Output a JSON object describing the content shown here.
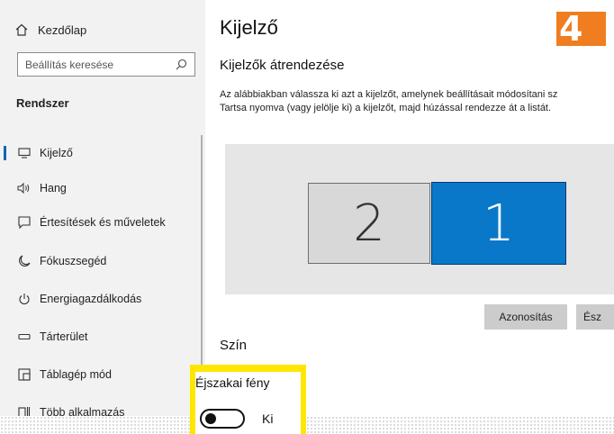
{
  "sidebar": {
    "home_label": "Kezdőlap",
    "search_placeholder": "Beállítás keresése",
    "section_title": "Rendszer",
    "items": [
      {
        "label": "Kijelző",
        "icon": "monitor-icon",
        "active": true
      },
      {
        "label": "Hang",
        "icon": "speaker-icon",
        "active": false
      },
      {
        "label": "Értesítések és műveletek",
        "icon": "notification-icon",
        "active": false
      },
      {
        "label": "Fókuszsegéd",
        "icon": "moon-icon",
        "active": false
      },
      {
        "label": "Energiagazdálkodás",
        "icon": "power-icon",
        "active": false
      },
      {
        "label": "Tárterület",
        "icon": "storage-icon",
        "active": false
      },
      {
        "label": "Táblagép mód",
        "icon": "tablet-mode-icon",
        "active": false
      },
      {
        "label": "Több alkalmazás",
        "icon": "multitasking-icon",
        "active": false
      }
    ]
  },
  "main": {
    "title": "Kijelző",
    "subtitle": "Kijelzők átrendezése",
    "description_line1": "Az alábbiakban válassza ki azt a kijelzőt, amelynek beállításait módosítani sz",
    "description_line2": "Tartsa nyomva (vagy jelölje ki) a kijelzőt, majd húzással rendezze át a listát.",
    "monitors": [
      {
        "number": "2",
        "selected": false
      },
      {
        "number": "1",
        "selected": true
      }
    ],
    "identify_button": "Azonosítás",
    "detect_button": "Ész",
    "color_section": "Szín"
  },
  "night_light": {
    "label": "Éjszakai fény",
    "state": "Ki"
  },
  "badge": "4",
  "colors": {
    "accent": "#0a78c8",
    "badge": "#f07d1f",
    "highlight": "#ffe600",
    "sidebar_bg": "#f2f2f2"
  }
}
